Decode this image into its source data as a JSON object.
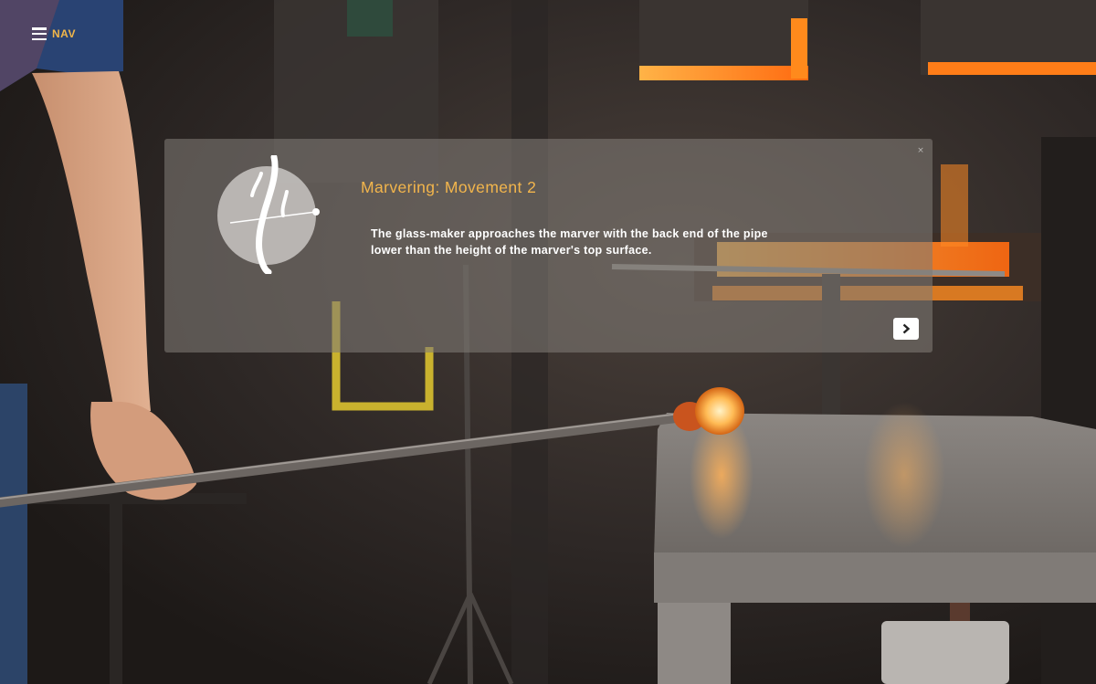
{
  "nav": {
    "label": "NAV",
    "icon": "hamburger-menu-icon"
  },
  "panel": {
    "title": "Marvering: Movement 2",
    "body": "The glass-maker approaches the marver with the back end of the pipe lower than the height of the marver's top surface.",
    "close_icon": "close-icon",
    "close_glyph": "×",
    "next_icon": "chevron-right-icon",
    "logo_icon": "calligraphic-logo-icon"
  },
  "colors": {
    "accent": "#f2b54c",
    "panel_background": "rgba(128,122,118,0.58)",
    "text": "#ffffff",
    "furnace_glow": "#ff8a1c"
  }
}
